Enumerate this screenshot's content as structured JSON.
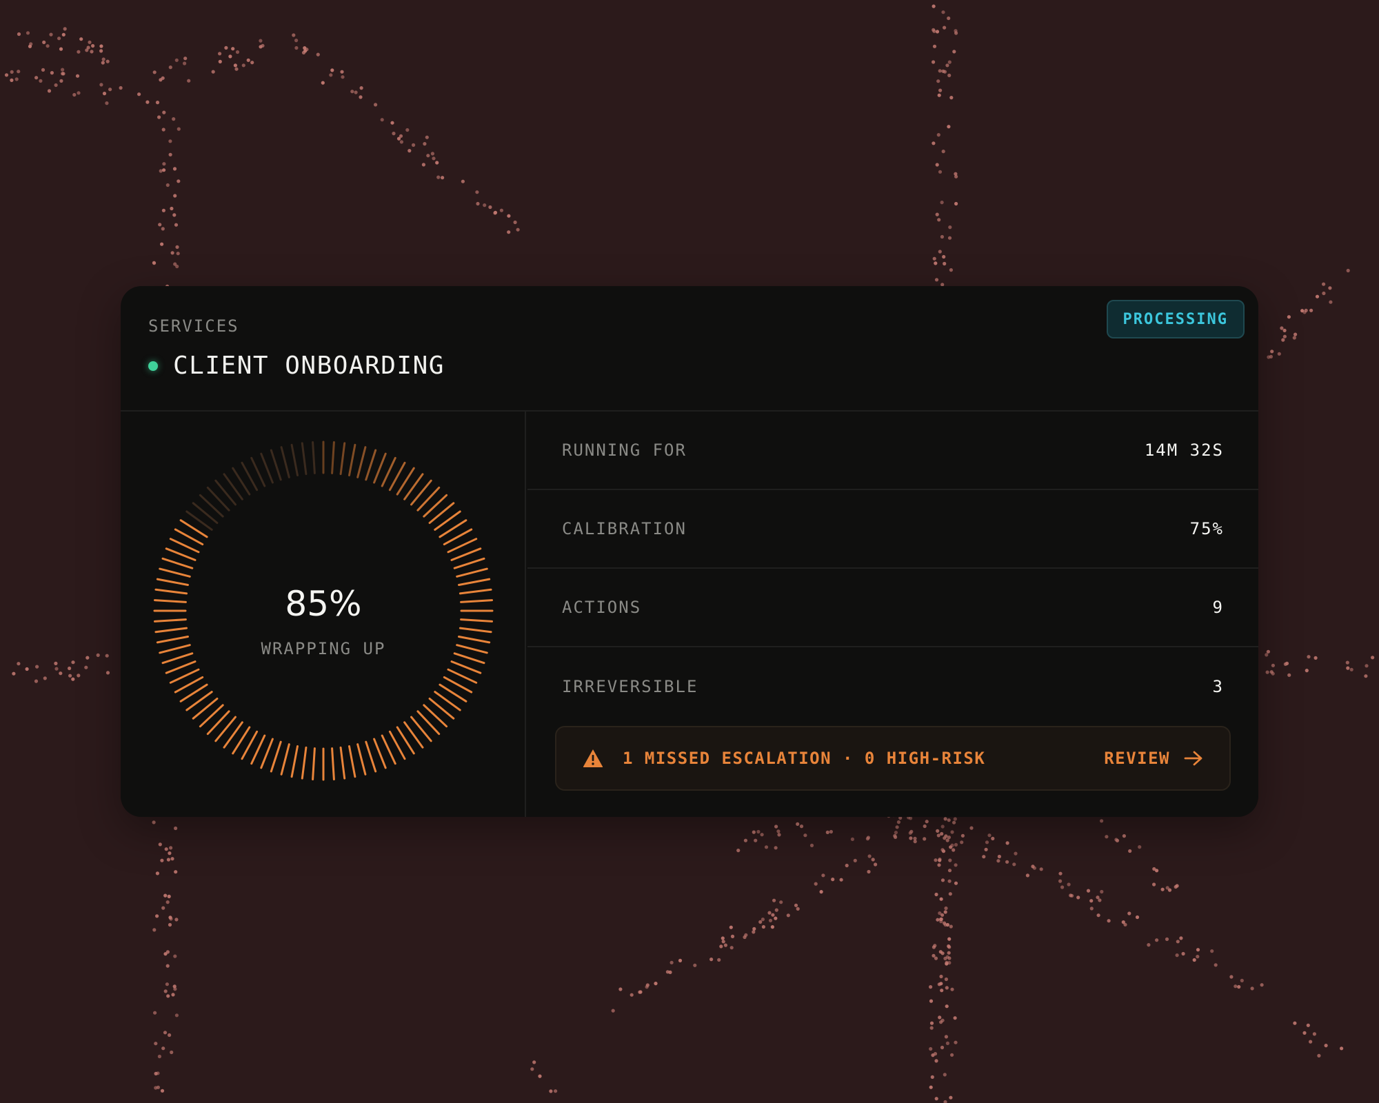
{
  "card": {
    "section_label": "SERVICES",
    "service_title": "CLIENT ONBOARDING",
    "status_badge": "PROCESSING",
    "status_dot_color": "#3fd19a",
    "badge_color": "#3cc7dd"
  },
  "gauge": {
    "value_label": "85%",
    "progress_fraction": 0.85,
    "caption": "WRAPPING UP",
    "active_color": "#e8843a",
    "inactive_color": "#3a2a1e"
  },
  "metrics": [
    {
      "label": "RUNNING FOR",
      "value": "14M 32S"
    },
    {
      "label": "CALIBRATION",
      "value": "75%"
    },
    {
      "label": "ACTIONS",
      "value": "9"
    },
    {
      "label": "IRREVERSIBLE",
      "value": "3"
    }
  ],
  "alert": {
    "icon": "warning-icon",
    "text": "1 MISSED ESCALATION · 0 HIGH-RISK",
    "action_label": "REVIEW",
    "action_icon": "arrow-right-icon",
    "color": "#e8843a"
  }
}
